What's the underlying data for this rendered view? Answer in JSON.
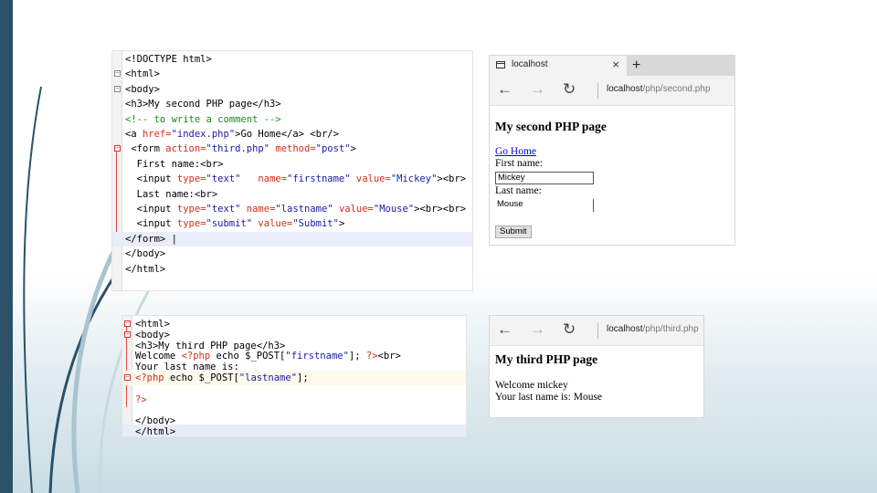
{
  "editor1": {
    "lines": [
      {
        "segments": [
          {
            "t": "<!DOCTYPE html>",
            "c": "tag"
          }
        ]
      },
      {
        "segments": [
          {
            "t": "<html>",
            "c": "tag"
          }
        ]
      },
      {
        "segments": [
          {
            "t": "<body>",
            "c": "tag"
          }
        ]
      },
      {
        "segments": [
          {
            "t": "<h3>My second PHP page</h3>",
            "c": "tag"
          }
        ]
      },
      {
        "segments": [
          {
            "t": "<!-- to write a comment -->",
            "c": "com"
          }
        ]
      },
      {
        "segments": [
          {
            "t": "<a ",
            "c": "tag"
          },
          {
            "t": "href=",
            "c": "attr"
          },
          {
            "t": "\"index.php\"",
            "c": "val"
          },
          {
            "t": ">Go Home</a> <br/>",
            "c": "tag"
          }
        ]
      },
      {
        "segments": [
          {
            "t": " <form ",
            "c": "tag"
          },
          {
            "t": "action=",
            "c": "attr"
          },
          {
            "t": "\"third.php\" ",
            "c": "val"
          },
          {
            "t": "method=",
            "c": "attr"
          },
          {
            "t": "\"post\"",
            "c": "val"
          },
          {
            "t": ">",
            "c": "tag"
          }
        ]
      },
      {
        "segments": [
          {
            "t": "  First name:<br>",
            "c": "tag"
          }
        ]
      },
      {
        "segments": [
          {
            "t": "  <input ",
            "c": "tag"
          },
          {
            "t": "type=",
            "c": "attr"
          },
          {
            "t": "\"text\"   ",
            "c": "val"
          },
          {
            "t": "name=",
            "c": "attr"
          },
          {
            "t": "\"firstname\" ",
            "c": "val"
          },
          {
            "t": "value=",
            "c": "attr"
          },
          {
            "t": "\"Mickey\"",
            "c": "val"
          },
          {
            "t": "><br>",
            "c": "tag"
          }
        ]
      },
      {
        "segments": [
          {
            "t": "  Last name:<br>",
            "c": "tag"
          }
        ]
      },
      {
        "segments": [
          {
            "t": "  <input ",
            "c": "tag"
          },
          {
            "t": "type=",
            "c": "attr"
          },
          {
            "t": "\"text\" ",
            "c": "val"
          },
          {
            "t": "name=",
            "c": "attr"
          },
          {
            "t": "\"lastname\" ",
            "c": "val"
          },
          {
            "t": "value=",
            "c": "attr"
          },
          {
            "t": "\"Mouse\"",
            "c": "val"
          },
          {
            "t": "><br><br>",
            "c": "tag"
          }
        ]
      },
      {
        "segments": [
          {
            "t": "  <input ",
            "c": "tag"
          },
          {
            "t": "type=",
            "c": "attr"
          },
          {
            "t": "\"submit\" ",
            "c": "val"
          },
          {
            "t": "value=",
            "c": "attr"
          },
          {
            "t": "\"Submit\"",
            "c": "val"
          },
          {
            "t": ">",
            "c": "tag"
          }
        ]
      },
      {
        "segments": [
          {
            "t": "</form> |",
            "c": "tag"
          }
        ]
      },
      {
        "segments": [
          {
            "t": "</body>",
            "c": "tag"
          }
        ]
      },
      {
        "segments": [
          {
            "t": "</html>",
            "c": "tag"
          }
        ]
      }
    ]
  },
  "editor2": {
    "lines": [
      {
        "segments": [
          {
            "t": "<html>",
            "c": "tag"
          }
        ]
      },
      {
        "segments": [
          {
            "t": "<body>",
            "c": "tag"
          }
        ]
      },
      {
        "segments": [
          {
            "t": "<h3>My third PHP page</h3>",
            "c": "tag"
          }
        ]
      },
      {
        "segments": [
          {
            "t": "Welcome ",
            "c": "tag"
          },
          {
            "t": "<?php ",
            "c": "php"
          },
          {
            "t": "echo $_POST[",
            "c": "tag"
          },
          {
            "t": "\"firstname\"",
            "c": "val"
          },
          {
            "t": "]; ",
            "c": "tag"
          },
          {
            "t": "?>",
            "c": "php"
          },
          {
            "t": "<br>",
            "c": "tag"
          }
        ]
      },
      {
        "segments": [
          {
            "t": "Your last name is:",
            "c": "tag"
          }
        ]
      },
      {
        "segments": [
          {
            "t": "<?php ",
            "c": "php"
          },
          {
            "t": "echo $_POST[",
            "c": "tag"
          },
          {
            "t": "\"lastname\"",
            "c": "val"
          },
          {
            "t": "];",
            "c": "tag"
          }
        ]
      },
      {
        "segments": [
          {
            "t": "",
            "c": "tag"
          }
        ]
      },
      {
        "segments": [
          {
            "t": "?>",
            "c": "php"
          }
        ]
      },
      {
        "segments": [
          {
            "t": "",
            "c": "tag"
          }
        ]
      },
      {
        "segments": [
          {
            "t": "</body>",
            "c": "tag"
          }
        ]
      },
      {
        "segments": [
          {
            "t": "</html>",
            "c": "tag"
          }
        ]
      }
    ]
  },
  "browser1": {
    "tab_title": "localhost",
    "tab_close": "×",
    "new_tab": "+",
    "address_host": "localhost",
    "address_path": "/php/second.php",
    "heading": "My second PHP page",
    "link_text": "Go Home",
    "first_label": "First name:",
    "first_value": "Mickey",
    "last_label": "Last name:",
    "last_value": "Mouse",
    "submit_label": "Submit"
  },
  "browser2": {
    "address_host": "localhost",
    "address_path": "/php/third.php",
    "heading": "My third PHP page",
    "welcome_line": "Welcome mickey",
    "last_line": "Your last name is: Mouse"
  },
  "icons": {
    "back": "←",
    "forward": "→",
    "refresh": "↻"
  },
  "colors": {
    "side_bar": "#2b5168",
    "code_attr": "#d12f1b",
    "code_value": "#1a1aa6",
    "code_comment": "#1c8b1c"
  }
}
